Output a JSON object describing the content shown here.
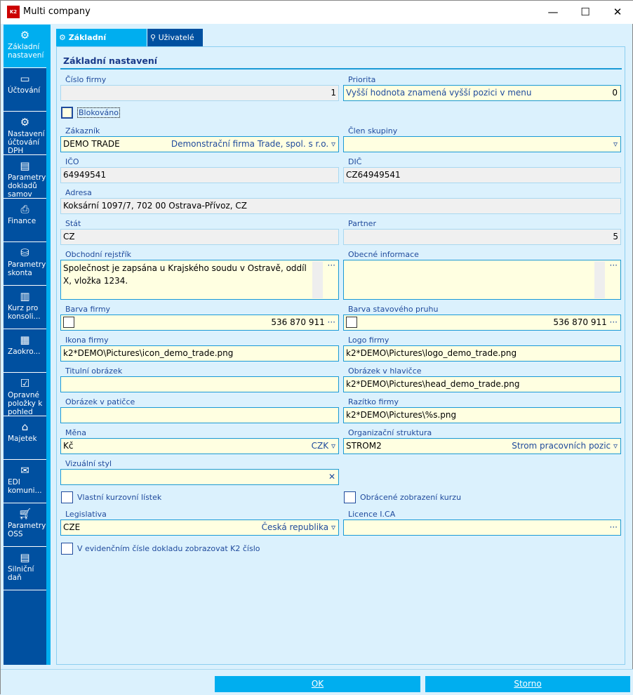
{
  "window": {
    "title": "Multi company",
    "logo_text": "K2"
  },
  "sidebar": {
    "items": [
      {
        "label": "Základní nastavení",
        "icon": "gear-icon"
      },
      {
        "label": "Účtování",
        "icon": "money-icon"
      },
      {
        "label": "Nastavení účtování DPH",
        "icon": "tax-settings-icon"
      },
      {
        "label": "Parametry dokladů samov",
        "icon": "document-icon"
      },
      {
        "label": "Finance",
        "icon": "printer-icon"
      },
      {
        "label": "Parametry skonta",
        "icon": "coins-icon"
      },
      {
        "label": "Kurz pro konsoli...",
        "icon": "report-icon"
      },
      {
        "label": "Zaokro...",
        "icon": "calculator-icon"
      },
      {
        "label": "Opravné položky k pohled",
        "icon": "checklist-icon"
      },
      {
        "label": "Majetek",
        "icon": "property-icon"
      },
      {
        "label": "EDI komuni...",
        "icon": "mail-settings-icon"
      },
      {
        "label": "Parametry OSS",
        "icon": "cart-icon"
      },
      {
        "label": "Silniční daň",
        "icon": "doc-settings-icon"
      }
    ]
  },
  "tabs": [
    {
      "label": "Základní nastavení"
    },
    {
      "label": "Uživatelé"
    }
  ],
  "section_title": "Základní nastavení",
  "fields": {
    "cislo_firmy": {
      "label": "Číslo firmy",
      "value": "1"
    },
    "priorita": {
      "label": "Priorita",
      "hint": "Vyšší hodnota znamená vyšší pozici v menu",
      "value": "0"
    },
    "blokovano": {
      "label": "Blokováno",
      "checked": false
    },
    "zakaznik": {
      "label": "Zákazník",
      "value": "DEMO TRADE",
      "description": "Demonstrační firma Trade, spol. s r.o."
    },
    "clen_skupiny": {
      "label": "Člen skupiny",
      "value": ""
    },
    "ico": {
      "label": "IČO",
      "value": "64949541"
    },
    "dic": {
      "label": "DIČ",
      "value": "CZ64949541"
    },
    "adresa": {
      "label": "Adresa",
      "value": "Koksární 1097/7, 702 00  Ostrava-Přívoz, CZ"
    },
    "stat": {
      "label": "Stát",
      "value": "CZ"
    },
    "partner": {
      "label": "Partner",
      "value": "5"
    },
    "obchodni_rejstrik": {
      "label": "Obchodní rejstřík",
      "value": "Společnost je zapsána u Krajského soudu v Ostravě, oddíl X, vložka 1234."
    },
    "obecne_informace": {
      "label": "Obecné informace",
      "value": ""
    },
    "barva_firmy": {
      "label": "Barva firmy",
      "value": "536 870 911"
    },
    "barva_pruhu": {
      "label": "Barva stavového pruhu",
      "value": "536 870 911"
    },
    "ikona_firmy": {
      "label": "Ikona firmy",
      "value": "k2*DEMO\\Pictures\\icon_demo_trade.png"
    },
    "logo_firmy": {
      "label": "Logo firmy",
      "value": "k2*DEMO\\Pictures\\logo_demo_trade.png"
    },
    "titulni_obrazek": {
      "label": "Titulní obrázek",
      "value": ""
    },
    "obrazek_hlavicka": {
      "label": "Obrázek v hlavičce",
      "value": "k2*DEMO\\Pictures\\head_demo_trade.png"
    },
    "obrazek_paticka": {
      "label": "Obrázek v patičce",
      "value": ""
    },
    "razitko": {
      "label": "Razítko firmy",
      "value": "k2*DEMO\\Pictures\\%s.png"
    },
    "mena": {
      "label": "Měna",
      "value": "Kč",
      "description": "CZK"
    },
    "org_struktura": {
      "label": "Organizační struktura",
      "value": "STROM2",
      "description": "Strom pracovních pozic"
    },
    "vizualni_styl": {
      "label": "Vizuální styl",
      "value": ""
    },
    "vlastni_kurzovni": {
      "label": "Vlastní kurzovní lístek",
      "checked": false
    },
    "obracene_zobrazeni": {
      "label": "Obrácené zobrazení kurzu",
      "checked": false
    },
    "legislativa": {
      "label": "Legislativa",
      "value": "CZE",
      "description": "Česká republika"
    },
    "licence": {
      "label": "Licence I.CA",
      "value": ""
    },
    "evidencni_cislo": {
      "label": "V evidenčním čísle dokladu zobrazovat K2 číslo",
      "checked": false
    }
  },
  "buttons": {
    "ok": "OK",
    "storno": "Storno"
  },
  "colors": {
    "sidebar": "#0050a0",
    "accent": "#00aeef",
    "input_bg": "#ffffe1",
    "readonly_bg": "#f0f0f0",
    "panel_bg": "#dbf1fd"
  }
}
